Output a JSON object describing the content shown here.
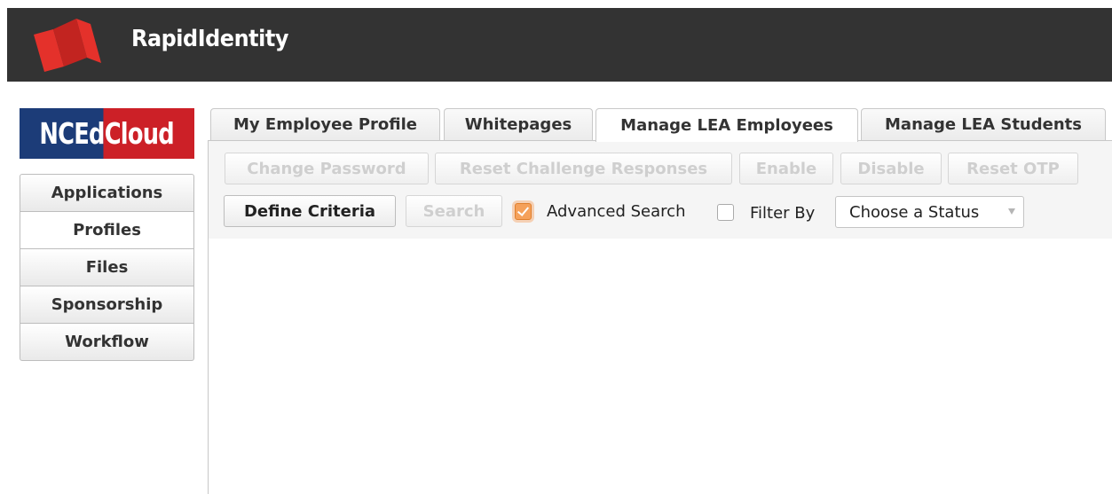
{
  "header": {
    "app_title": "RapidIdentity",
    "bar_color": "#333333",
    "logo_color": "#e4312b"
  },
  "sidebar": {
    "brand": "NCEdCloud",
    "items": [
      {
        "label": "Applications"
      },
      {
        "label": "Profiles",
        "active": true
      },
      {
        "label": "Files"
      },
      {
        "label": "Sponsorship"
      },
      {
        "label": "Workflow"
      }
    ]
  },
  "tabs": [
    {
      "label": "My Employee Profile"
    },
    {
      "label": "Whitepages"
    },
    {
      "label": "Manage LEA Employees",
      "active": true
    },
    {
      "label": "Manage LEA Students"
    }
  ],
  "actions": {
    "change_password": "Change Password",
    "reset_challenge": "Reset Challenge Responses",
    "enable": "Enable",
    "disable": "Disable",
    "reset_otp": "Reset OTP"
  },
  "search": {
    "define_criteria": "Define Criteria",
    "search": "Search",
    "advanced_search": {
      "label": "Advanced Search",
      "checked": true
    },
    "filter_by": {
      "label": "Filter By",
      "checked": false
    },
    "status_select": "Choose a Status"
  }
}
